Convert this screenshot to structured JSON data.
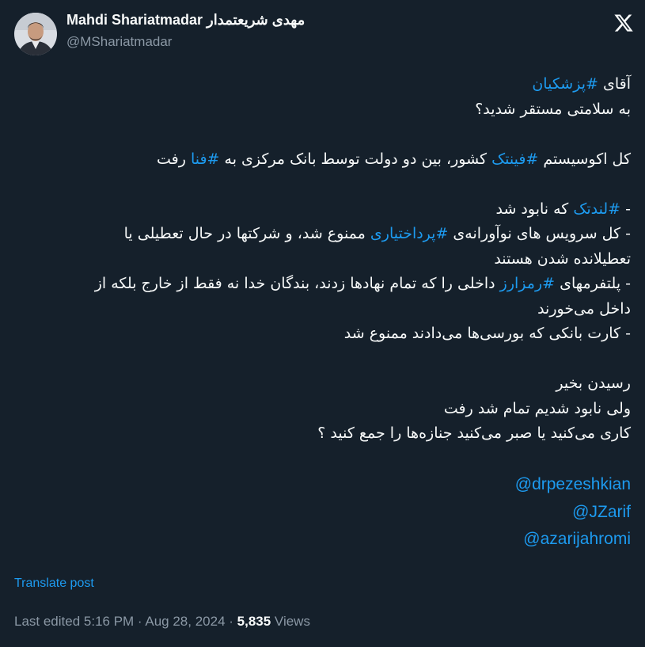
{
  "author": {
    "display_name": "Mahdi Shariatmadar مهدی شریعتمدار",
    "handle": "@MShariatmadar"
  },
  "icons": {
    "avatar": "profile-photo",
    "brand": "x-logo-icon"
  },
  "colors": {
    "background": "#15202b",
    "text": "#f7f9f9",
    "secondary": "#8b98a5",
    "link": "#1d9bf0"
  },
  "tweet": {
    "l1_pre": "آقای ",
    "l1_tag": "#پزشکیان",
    "l2": "به سلامتی مستقر شدید؟",
    "l3_pre": "کل اکوسیستم ",
    "l3_tag1": "#فینتک",
    "l3_mid": " کشور، بین دو دولت توسط بانک مرکزی به ",
    "l3_tag2": "#فنا",
    "l3_post": " رفت",
    "l4_pre": "- ",
    "l4_tag": "#لندتک",
    "l4_post": " که نابود شد",
    "l5_pre": "- کل سرویس های نوآورانه‌ی ",
    "l5_tag": "#پرداختیاری",
    "l5_post": " ممنوع شد، و شرکتها در حال تعطیلی یا",
    "l6": "تعطیلانده شدن هستند",
    "l7_pre": "- پلتفرمهای ",
    "l7_tag": "#رمزارز",
    "l7_post": " داخلی را که تمام نهادها زدند، بندگان خدا نه فقط از خارج بلکه از",
    "l8": "داخل می‌خورند",
    "l9": "- کارت بانکی که بورسی‌ها می‌دادند ممنوع شد",
    "l10": "رسیدن بخیر",
    "l11": "ولی نابود شدیم تمام شد رفت",
    "l12": "کاری می‌کنید یا صبر می‌کنید جنازه‌ها را جمع کنید ؟",
    "mentions": [
      "@drpezeshkian",
      "@JZarif",
      "@azarijahromi"
    ]
  },
  "translate_label": "Translate post",
  "meta": {
    "edited": "Last edited 5:16 PM · Aug 28, 2024 · ",
    "views_count": "5,835",
    "views_label": " Views"
  }
}
